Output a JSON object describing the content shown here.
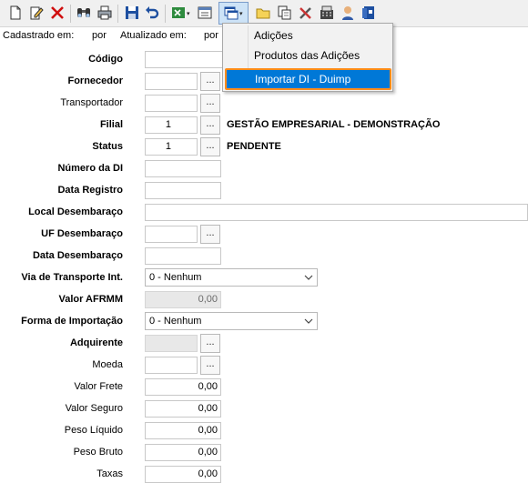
{
  "toolbar": {
    "buttons": [
      {
        "name": "new-document-icon"
      },
      {
        "name": "edit-document-icon"
      },
      {
        "name": "delete-icon"
      },
      {
        "name": "binoculars-search-icon"
      },
      {
        "name": "print-icon"
      },
      {
        "name": "save-icon"
      },
      {
        "name": "undo-icon"
      },
      {
        "name": "spreadsheet-export-icon"
      },
      {
        "name": "calendar-form-icon"
      },
      {
        "name": "windows-menu-icon"
      },
      {
        "name": "folder-icon"
      },
      {
        "name": "copy-pages-icon"
      },
      {
        "name": "tools-icon"
      },
      {
        "name": "calculator-icon"
      },
      {
        "name": "user-icon"
      },
      {
        "name": "book-help-icon"
      }
    ]
  },
  "info": {
    "created_label": "Cadastrado em:",
    "created_by": "por",
    "updated_label": "Atualizado em:",
    "updated_by": "por"
  },
  "menu": {
    "items": [
      "Adições",
      "Produtos das Adições",
      "Importar DI - Duimp"
    ]
  },
  "form": {
    "codigo": "Código",
    "fornecedor": "Fornecedor",
    "transportador": "Transportador",
    "filial": "Filial",
    "filial_value": "1",
    "filial_desc": "GESTÃO EMPRESARIAL - DEMONSTRAÇÃO",
    "status": "Status",
    "status_value": "1",
    "status_desc": "PENDENTE",
    "numero_di": "Número da DI",
    "data_registro": "Data Registro",
    "local_desembaraco": "Local Desembaraço",
    "uf_desembaraco": "UF Desembaraço",
    "data_desembaraco": "Data Desembaraço",
    "via_transporte": "Via de Transporte Int.",
    "via_transporte_value": "0 - Nenhum",
    "valor_afrmm": "Valor AFRMM",
    "valor_afrmm_value": "0,00",
    "forma_importacao": "Forma de Importação",
    "forma_importacao_value": "0 - Nenhum",
    "adquirente": "Adquirente",
    "moeda": "Moeda",
    "valor_frete": "Valor Frete",
    "valor_frete_value": "0,00",
    "valor_seguro": "Valor Seguro",
    "valor_seguro_value": "0,00",
    "peso_liquido": "Peso Líquido",
    "peso_liquido_value": "0,00",
    "peso_bruto": "Peso Bruto",
    "peso_bruto_value": "0,00",
    "taxas": "Taxas",
    "taxas_value": "0,00",
    "lookup_label": "..."
  }
}
